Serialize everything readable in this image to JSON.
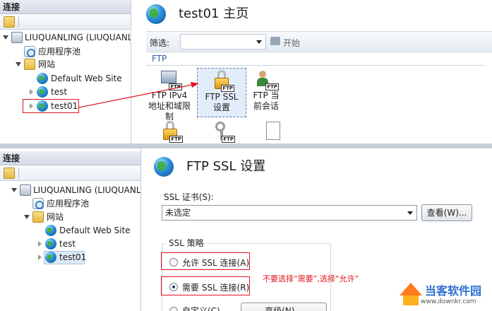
{
  "colors": {
    "accent_red": "#e0141e",
    "selection": "#dfe8f5",
    "header": "#d3dbe7"
  },
  "top": {
    "connections_title": "连接",
    "tree": {
      "server": "LIUQUANLING (LIUQUANLING",
      "app_pools": "应用程序池",
      "sites": "网站",
      "default_site": "Default Web Site",
      "site_test": "test",
      "site_test01": "test01"
    },
    "page_title": "test01 主页",
    "filter_label": "筛选:",
    "go_label": "开始",
    "section": "FTP",
    "features": [
      {
        "label": "FTP IPv4 地址和域限制"
      },
      {
        "label": "FTP SSL 设置"
      },
      {
        "label": "FTP 当前会话"
      }
    ]
  },
  "bottom": {
    "connections_title": "连接",
    "tree": {
      "server": "LIUQUANLING (LIUQUANLING",
      "app_pools": "应用程序池",
      "sites": "网站",
      "default_site": "Default Web Site",
      "site_test": "test",
      "site_test01": "test01"
    },
    "page_title": "FTP SSL 设置",
    "ssl_cert_label": "SSL 证书(S):",
    "ssl_cert_value": "未选定",
    "view_button": "查看(W)...",
    "policy_title": "SSL 策略",
    "radio_allow": "允许 SSL 连接(A)",
    "radio_require": "需要 SSL 连接(R)",
    "radio_custom": "自定义(C)",
    "advanced_button": "高级(N)...",
    "annotation": "不要选择“需要”,选择“允许”"
  },
  "watermark": {
    "brand": "当客软件园",
    "url": "www.downkr.com"
  }
}
